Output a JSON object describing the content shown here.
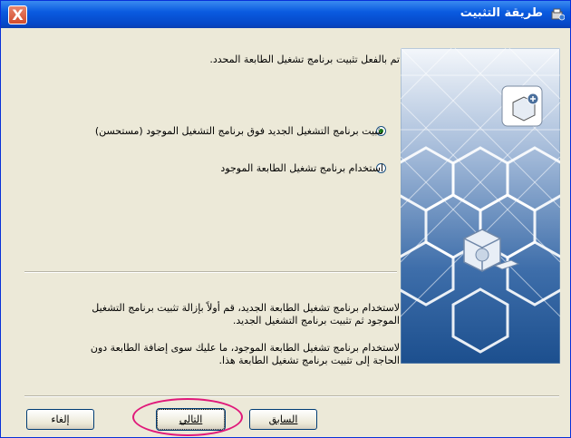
{
  "window": {
    "title": "طريقة التثبيت",
    "close_label": "X"
  },
  "main": {
    "intro": "تم بالفعل تثبيت برنامج تشغيل الطابعة المحدد.",
    "options": [
      {
        "label": "تثبيت برنامج التشغيل الجديد فوق برنامج التشغيل الموجود (مستحسن)",
        "selected": true
      },
      {
        "label": "استخدام برنامج تشغيل الطابعة الموجود",
        "selected": false
      }
    ],
    "note1_line1": "لاستخدام برنامج تشغيل الطابعة الجديد، قم أولاً بإزالة تثبيت برنامج التشغيل",
    "note1_line2": "الموجود ثم تثبيت برنامج التشغيل الجديد.",
    "note2_line1": "لاستخدام برنامج تشغيل الطابعة الموجود، ما عليك سوى إضافة الطابعة دون",
    "note2_line2": "الحاجة إلى تثبيت برنامج تشغيل الطابعة هذا."
  },
  "buttons": {
    "back": "السابق",
    "next": "التالي",
    "cancel": "إلغاء"
  },
  "colors": {
    "titlebar": "#0a5be0",
    "highlight_ring": "#e0197a",
    "panel": "#2a5fa0"
  }
}
